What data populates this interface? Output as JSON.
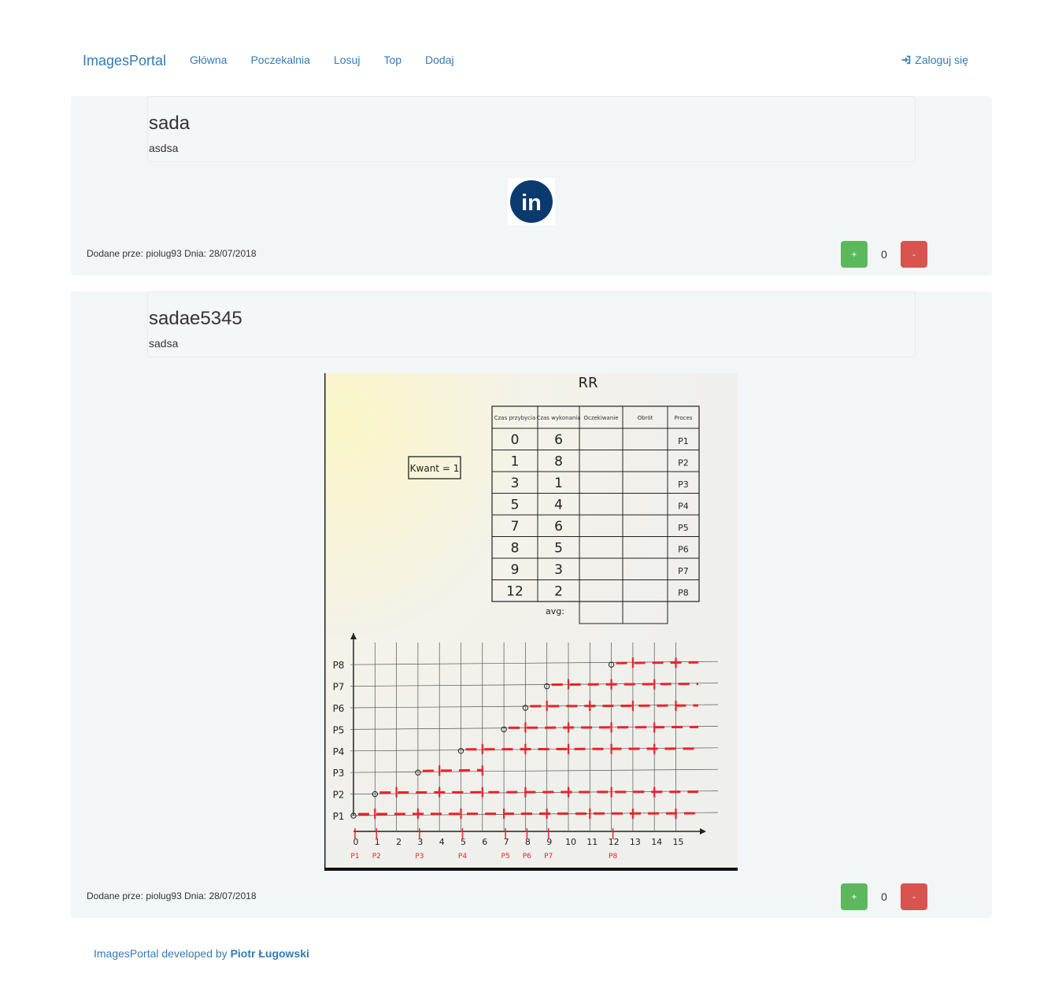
{
  "nav": {
    "brand": "ImagesPortal",
    "links": [
      "Główna",
      "Poczekalnia",
      "Losuj",
      "Top",
      "Dodaj"
    ],
    "login": "Zaloguj się"
  },
  "posts": [
    {
      "title": "sada",
      "description": "asdsa",
      "meta": "Dodane prze: piolug93 Dnia: 28/07/2018",
      "plus": "+",
      "score": "0",
      "minus": "-",
      "image_logo_text": "in"
    },
    {
      "title": "sadae5345",
      "description": "sadsa",
      "meta": "Dodane prze: piolug93 Dnia: 28/07/2018",
      "plus": "+",
      "score": "0",
      "minus": "-",
      "photo": {
        "title": "RR",
        "kwant": "Kwant = 1",
        "table_headers": [
          "Czas przybycia",
          "Czas wykonania",
          "Oczekiwanie",
          "Obrót",
          "Proces"
        ],
        "table_rows": [
          [
            "0",
            "6",
            "",
            "",
            "P1"
          ],
          [
            "1",
            "8",
            "",
            "",
            "P2"
          ],
          [
            "3",
            "1",
            "",
            "",
            "P3"
          ],
          [
            "5",
            "4",
            "",
            "",
            "P4"
          ],
          [
            "7",
            "6",
            "",
            "",
            "P5"
          ],
          [
            "8",
            "5",
            "",
            "",
            "P6"
          ],
          [
            "9",
            "3",
            "",
            "",
            "P7"
          ],
          [
            "12",
            "2",
            "",
            "",
            "P8"
          ]
        ],
        "avg_label": "avg:",
        "y_labels": [
          "P8",
          "P7",
          "P6",
          "P5",
          "P4",
          "P3",
          "P2",
          "P1"
        ],
        "x_labels": [
          "0",
          "1",
          "2",
          "3",
          "4",
          "5",
          "6",
          "7",
          "8",
          "9",
          "10",
          "11",
          "12",
          "13",
          "14",
          "15"
        ],
        "arrival_labels": [
          "P1",
          "P2",
          "P3",
          "P4",
          "P5",
          "P6",
          "P7",
          "P8"
        ]
      }
    }
  ],
  "footer": {
    "prefix": "ImagesPortal developed by ",
    "author": "Piotr Ługowski"
  },
  "colors": {
    "link": "#337ab7",
    "panel": "#f3f6f7",
    "plus": "#5cb85c",
    "minus": "#d9534f",
    "linkedin": "#0a3a6e",
    "marker": "#e8232a"
  }
}
